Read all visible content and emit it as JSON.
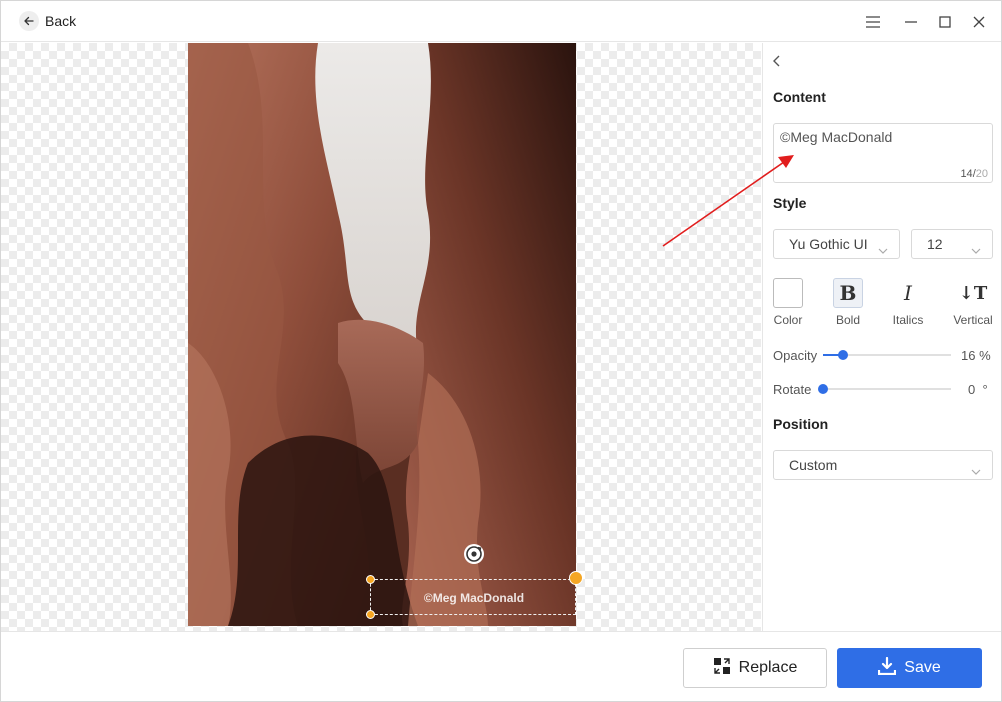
{
  "header": {
    "back_label": "Back",
    "icons": {
      "back": "arrow-left-icon",
      "menu": "hamburger-menu-icon",
      "minimize": "minimize-icon",
      "maximize": "maximize-icon",
      "close": "close-icon"
    }
  },
  "canvas": {
    "watermark_text": "©Meg MacDonald",
    "icons": {
      "rotate": "rotate-icon"
    }
  },
  "panel": {
    "content_title": "Content",
    "content_value": "©Meg MacDonald",
    "counter_current": "14",
    "counter_max": "20",
    "style_title": "Style",
    "font_family": "Yu Gothic UI",
    "font_size": "12",
    "style_buttons": {
      "color_label": "Color",
      "bold_label": "Bold",
      "italics_label": "Italics",
      "vertical_label": "Vertical",
      "bold_glyph": "B",
      "italics_glyph": "I",
      "vertical_glyph": "↓T"
    },
    "opacity_label": "Opacity",
    "opacity_value": "16",
    "opacity_unit": "%",
    "opacity_fraction": 0.16,
    "rotate_label": "Rotate",
    "rotate_value": "0",
    "rotate_unit": "°",
    "rotate_fraction": 0,
    "position_title": "Position",
    "position_value": "Custom"
  },
  "footer": {
    "replace_label": "Replace",
    "save_label": "Save",
    "icons": {
      "replace": "replace-icon",
      "save": "download-icon"
    }
  },
  "colors": {
    "accent": "#2f6ee6",
    "handle": "#f5a623",
    "annotation_arrow": "#e11d1d"
  }
}
